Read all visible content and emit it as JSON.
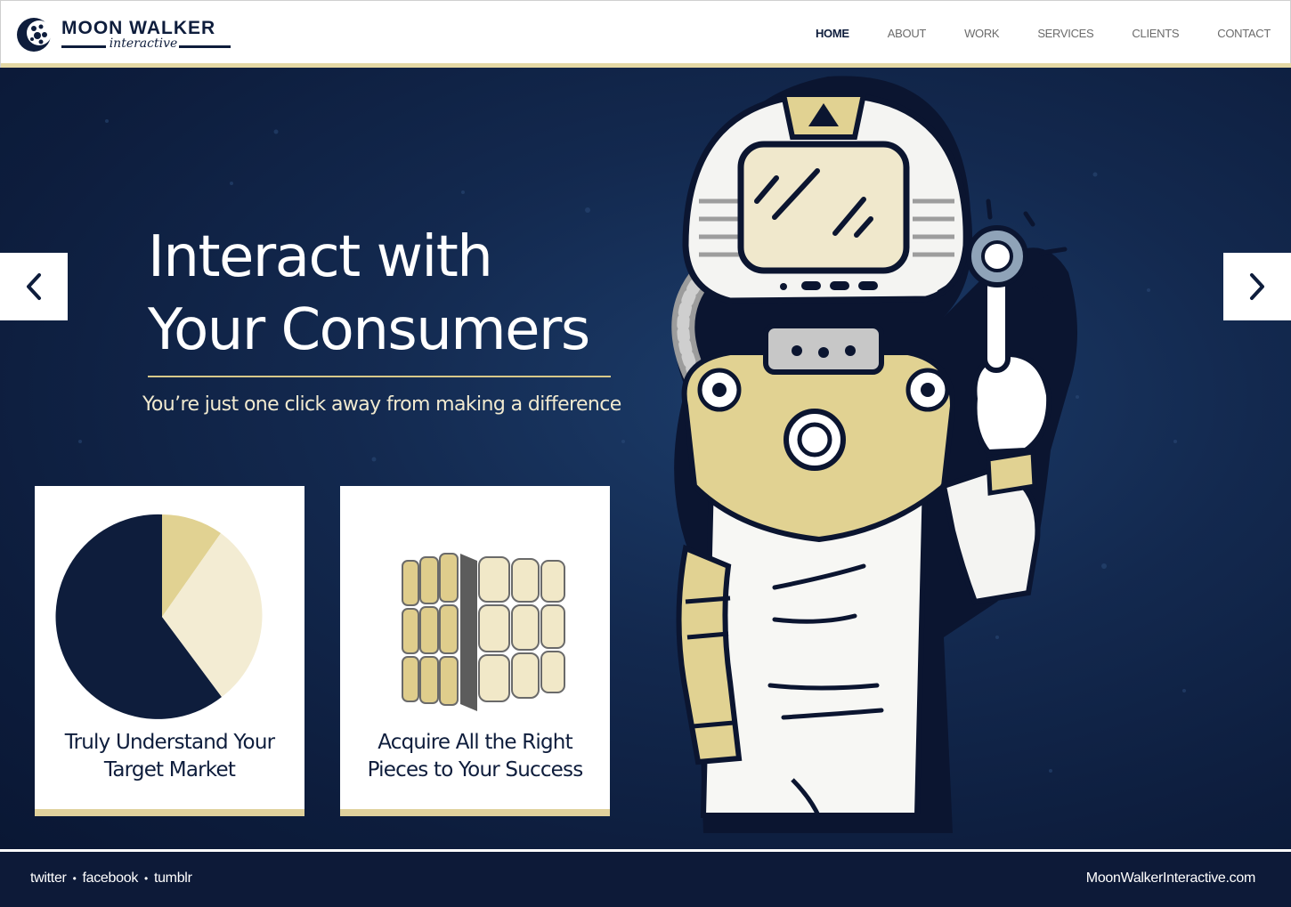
{
  "brand": {
    "name": "MOON WALKER",
    "tagline": "interactive"
  },
  "nav": {
    "items": [
      {
        "label": "HOME",
        "active": true
      },
      {
        "label": "ABOUT",
        "active": false
      },
      {
        "label": "WORK",
        "active": false
      },
      {
        "label": "SERVICES",
        "active": false
      },
      {
        "label": "CLIENTS",
        "active": false
      },
      {
        "label": "CONTACT",
        "active": false
      }
    ]
  },
  "hero": {
    "headline_line1": "Interact with",
    "headline_line2": "Your Consumers",
    "subheading": "You’re just one click away from making a difference",
    "prev_icon": "chevron-left-icon",
    "next_icon": "chevron-right-icon"
  },
  "cards": [
    {
      "icon": "pie-chart-icon",
      "line1": "Truly Understand Your",
      "line2": "Target Market"
    },
    {
      "icon": "cube-puzzle-icon",
      "line1": "Acquire All the Right",
      "line2": "Pieces to Your Success"
    }
  ],
  "footer": {
    "social": [
      "twitter",
      "facebook",
      "tumblr"
    ],
    "separator": "•",
    "site": "MoonWalkerInteractive.com"
  },
  "colors": {
    "navy": "#0e1d3c",
    "gold": "#e0d19c",
    "cream": "#f3ecd3",
    "white": "#ffffff"
  }
}
